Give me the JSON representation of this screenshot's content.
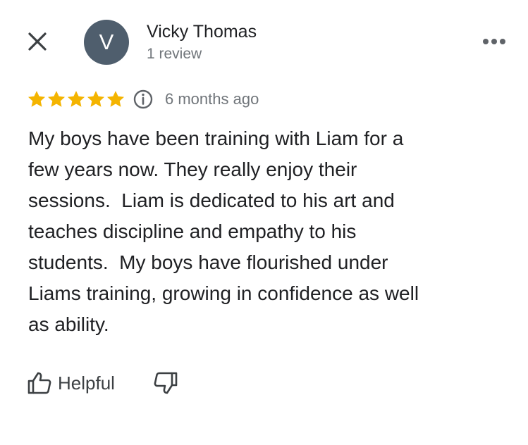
{
  "header": {
    "avatar_letter": "V",
    "avatar_color": "#4f5e6d",
    "reviewer_name": "Vicky Thomas",
    "review_count": "1 review",
    "close_icon": "close-icon",
    "more_icon": "more-horizontal-icon"
  },
  "rating": {
    "stars": 5,
    "max_stars": 5,
    "star_color": "#f4b400",
    "time": "6 months ago",
    "info_icon": "info-icon"
  },
  "review": {
    "text": "My boys have been training with Liam for a\nfew years now. They really enjoy their\nsessions.  Liam is dedicated to his art and\nteaches discipline and empathy to his\nstudents.  My boys have flourished under\nLiams training, growing in confidence as well\nas ability."
  },
  "actions": {
    "helpful_label": "Helpful",
    "helpful_icon": "thumbs-up-icon",
    "unhelpful_icon": "thumbs-down-icon"
  }
}
